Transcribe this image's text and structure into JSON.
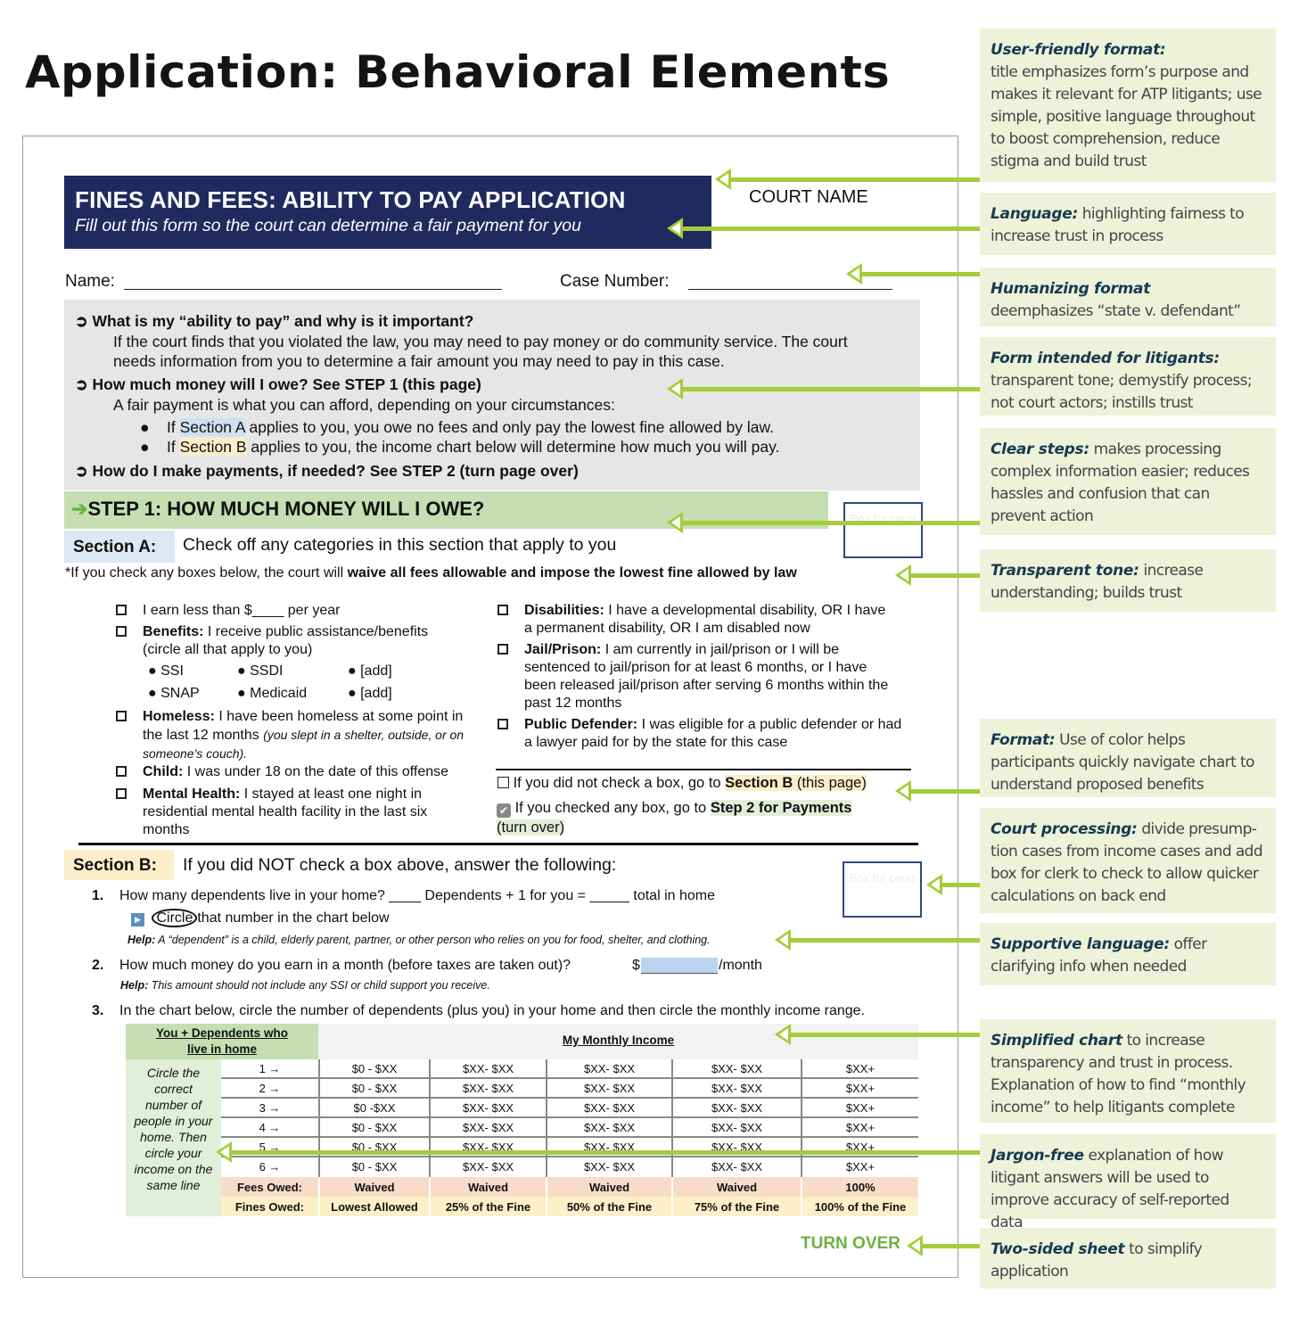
{
  "title": "Application: Behavioral Elements",
  "form": {
    "header_title": "FINES AND FEES: ABILITY TO PAY APPLICATION",
    "header_subtitle": "Fill out this form so the court can determine a fair payment for you",
    "court_name": "COURT NAME",
    "name_label": "Name:",
    "case_number_label": "Case Number:",
    "info": {
      "q1": "What is my “ability to pay” and why is it important?",
      "a1_line1": "If the court finds that you violated the law, you may need to pay money or do community service. The court",
      "a1_line2": "needs information from you to determine a fair amount you may need to pay in this case.",
      "q2": "How much money will I owe? See STEP 1 (this page)",
      "a2": "A fair payment is what you can afford, depending on your circumstances:",
      "bullet_a_pre": "If ",
      "bullet_a_hl": "Section A",
      "bullet_a_post": " applies to you, you owe no fees and only pay the lowest fine allowed by law.",
      "bullet_b_pre": "If ",
      "bullet_b_hl": "Section B",
      "bullet_b_post": " applies to you, the income chart below will determine how much you will pay.",
      "q3": "How do I make payments, if needed? See STEP 2 (turn page over)"
    },
    "step1_title": "STEP 1: HOW MUCH MONEY WILL I OWE?",
    "court_box_label": "Box for court",
    "section_a": {
      "label": "Section A:",
      "desc": "Check off any categories in this section that apply to you",
      "note_pre": "*If you check any boxes below, the court will ",
      "note_bold": "waive all fees allowable and impose the lowest fine allowed by law",
      "left_items": [
        {
          "bold": "",
          "text": "I earn less than $____  per year"
        },
        {
          "bold": "Benefits:",
          "text": " I receive public assistance/benefits (circle all that apply to you)"
        },
        {
          "bold": "Homeless:",
          "text": " I have been homeless at some point in the last 12 months ",
          "italic": "(you slept in a shelter, outside, or on someone's couch)."
        },
        {
          "bold": "Child:",
          "text": " I was under 18 on the date of this offense"
        },
        {
          "bold": "Mental Health:",
          "text": " I stayed at least one night in residential mental health facility in the last six months"
        }
      ],
      "benefits": [
        "SSI",
        "SSDI",
        "[add]",
        "SNAP",
        "Medicaid",
        "[add]"
      ],
      "right_items": [
        {
          "bold": "Disabilities:",
          "text": " I have a developmental disability, OR I have a permanent disability, OR I am disabled now"
        },
        {
          "bold": "Jail/Prison:",
          "text": " I am currently in jail/prison or I will be sentenced to jail/prison for at least 6 months, or I have been released jail/prison after serving 6 months within the past 12 months"
        },
        {
          "bold": "Public Defender:",
          "text": " I was eligible for a public defender or had a lawyer paid for by the state for this case"
        }
      ],
      "route_b_pre": "If you did not check a box, go to ",
      "route_b_bold": "Section B",
      "route_b_post": " (this page)",
      "route_step2_pre": "If you checked any box, go to ",
      "route_step2_bold": "Step 2 for Payments",
      "route_step2_post": "(turn over)"
    },
    "section_b": {
      "label": "Section B:",
      "desc": "If you did NOT check a box above, answer the following:",
      "q1_num": "1.",
      "q1": "How many dependents live in your home? ____ Dependents + 1 for you =     _____ total in home",
      "q1_sub_circle": "Circle",
      "q1_sub": "that number in the chart below",
      "q1_help_label": "Help:",
      "q1_help": " A “dependent” is a child, elderly parent, partner, or other person who relies on you for food, shelter, and clothing.",
      "q2_num": "2.",
      "q2": "How much money do you earn in a month (before taxes are taken out)?",
      "q2_currency": "$",
      "q2_unit": "/month",
      "q2_help_label": "Help:",
      "q2_help": " This amount should not include any SSI or child support you receive.",
      "q3_num": "3.",
      "q3": "In the chart below, circle the number of dependents (plus you) in your home and then circle the monthly income range."
    },
    "chart": {
      "header_left": "You + Dependents who live in home",
      "header_right": "My Monthly Income",
      "instruction": "Circle the correct number of people in your home. Then circle your income on the same line",
      "rows": [
        {
          "people": "1 →",
          "cells": [
            "$0 - $XX",
            "$XX- $XX",
            "$XX- $XX",
            "$XX- $XX",
            "$XX+"
          ]
        },
        {
          "people": "2 →",
          "cells": [
            "$0 - $XX",
            "$XX- $XX",
            "$XX- $XX",
            "$XX- $XX",
            "$XX+"
          ]
        },
        {
          "people": "3 →",
          "cells": [
            "$0 -$XX",
            "$XX- $XX",
            "$XX- $XX",
            "$XX- $XX",
            "$XX+"
          ]
        },
        {
          "people": "4 →",
          "cells": [
            "$0 - $XX",
            "$XX- $XX",
            "$XX- $XX",
            "$XX- $XX",
            "$XX+"
          ]
        },
        {
          "people": "5 →",
          "cells": [
            "$0 - $XX",
            "$XX- $XX",
            "$XX- $XX",
            "$XX- $XX",
            "$XX+"
          ]
        },
        {
          "people": "6 →",
          "cells": [
            "$0 - $XX",
            "$XX- $XX",
            "$XX- $XX",
            "$XX- $XX",
            "$XX+"
          ]
        }
      ],
      "fees_label": "Fees Owed:",
      "fees": [
        "Waived",
        "Waived",
        "Waived",
        "Waived",
        "100%"
      ],
      "fines_label": "Fines Owed:",
      "fines": [
        "Lowest Allowed",
        "25% of the Fine",
        "50% of the Fine",
        "75% of the Fine",
        "100% of the Fine"
      ]
    },
    "turn_over": "TURN OVER"
  },
  "annotations": [
    {
      "title": "User-friendly format:",
      "text": "title emphasizes form’s purpose and makes it relevant for ATP litigants; use simple, positive language throughout to boost comprehension, reduce stigma and build trust"
    },
    {
      "title": "Language:",
      "text": " highlighting fairness to increase trust in process"
    },
    {
      "title": "Humanizing format",
      "text": "deemphasizes “state v. defendant”"
    },
    {
      "title": "Form intended for litigants:",
      "text": "transparent tone; demystify process; not court actors; instills trust"
    },
    {
      "title": "Clear steps:",
      "text": " makes processing complex information easier; reduces hassles and confusion that can prevent action"
    },
    {
      "title": "Transparent tone:",
      "text": " increase understanding; builds trust"
    },
    {
      "title": "Format:",
      "text": " Use of color helps participants quickly navigate chart to understand proposed benefits"
    },
    {
      "title": "Court processing:",
      "text": " divide presump-tion cases from income cases and add box for clerk to check to allow quicker calculations on back end"
    },
    {
      "title": "Supportive language:",
      "text": " offer clarifying info when needed"
    },
    {
      "title": "Simplified chart",
      "text": " to increase transparency and trust in process. Explanation of how to find “monthly income” to help litigants complete"
    },
    {
      "title": "Jargon-free",
      "text": " explanation of how litigant answers will be used to improve accuracy of self-reported data"
    },
    {
      "title": "Two-sided sheet",
      "text": " to simplify application"
    }
  ],
  "colors": {
    "banner_navy": "#1f2a5e",
    "step_green": "#c5dfb2",
    "section_a_blue": "#dce8f4",
    "section_b_yellow": "#fbeec8",
    "fees_peach": "#f8dcc8",
    "fines_yellow": "#fdf0c8",
    "arrow_green": "#a5cc3a",
    "annotation_bg": "#eef2d9",
    "annotation_title": "#173a52",
    "turn_over_green": "#6cb33f"
  }
}
